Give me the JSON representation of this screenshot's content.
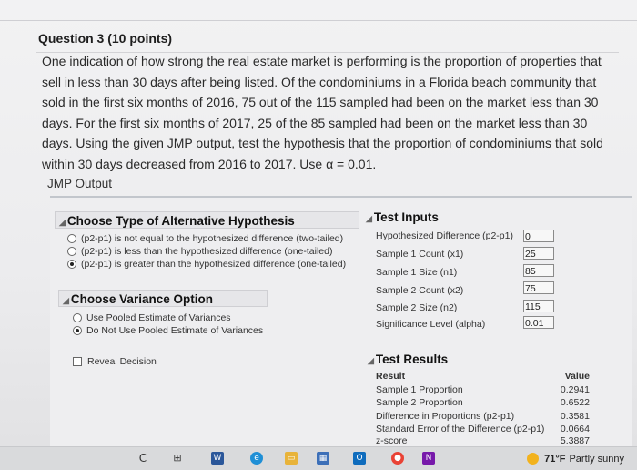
{
  "question": {
    "title": "Question 3 (10 points)",
    "body": "One indication of how strong the real estate market is performing is the proportion of properties that sell in less than 30 days after being listed. Of the condominiums in a Florida beach community that sold in the first six months of 2016, 75 out of the 115 sampled had been on the market less than 30 days. For the first six months of 2017, 25 of the 85 sampled had been on the market less than 30 days. Using the given JMP output, test the hypothesis that the proportion of condominiums that sold within 30 days decreased from 2016 to 2017. Use α = 0.01.",
    "jmp_label": "JMP Output"
  },
  "alternative": {
    "title": "Choose Type of Alternative Hypothesis",
    "options": [
      {
        "label": "(p2-p1) is not equal to the hypothesized difference (two-tailed)",
        "selected": false
      },
      {
        "label": "(p2-p1) is less than the hypothesized difference (one-tailed)",
        "selected": false
      },
      {
        "label": "(p2-p1) is greater than the hypothesized difference (one-tailed)",
        "selected": true
      }
    ]
  },
  "variance": {
    "title": "Choose Variance Option",
    "options": [
      {
        "label": "Use Pooled Estimate of Variances",
        "selected": false
      },
      {
        "label": "Do Not Use Pooled Estimate of Variances",
        "selected": true
      }
    ]
  },
  "reveal": {
    "label": "Reveal Decision",
    "checked": false
  },
  "test_inputs": {
    "title": "Test Inputs",
    "rows": [
      {
        "label": "Hypothesized Difference (p2-p1)",
        "value": "0"
      },
      {
        "label": "Sample 1 Count (x1)",
        "value": "25"
      },
      {
        "label": "Sample 1 Size (n1)",
        "value": "85"
      },
      {
        "label": "Sample 2 Count (x2)",
        "value": "75"
      },
      {
        "label": "Sample 2 Size (n2)",
        "value": "115"
      },
      {
        "label": "Significance Level (alpha)",
        "value": "0.01"
      }
    ]
  },
  "test_results": {
    "title": "Test Results",
    "col_result": "Result",
    "col_value": "Value",
    "rows": [
      {
        "label": "Sample 1 Proportion",
        "value": "0.2941"
      },
      {
        "label": "Sample 2 Proportion",
        "value": "0.6522"
      },
      {
        "label": "Difference in Proportions (p2-p1)",
        "value": "0.3581"
      },
      {
        "label": "Standard Error of the Difference (p2-p1)",
        "value": "0.0664"
      },
      {
        "label": "z-score",
        "value": "5.3887"
      }
    ]
  },
  "taskbar": {
    "temperature": "71°F",
    "condition": "Partly sunny"
  }
}
